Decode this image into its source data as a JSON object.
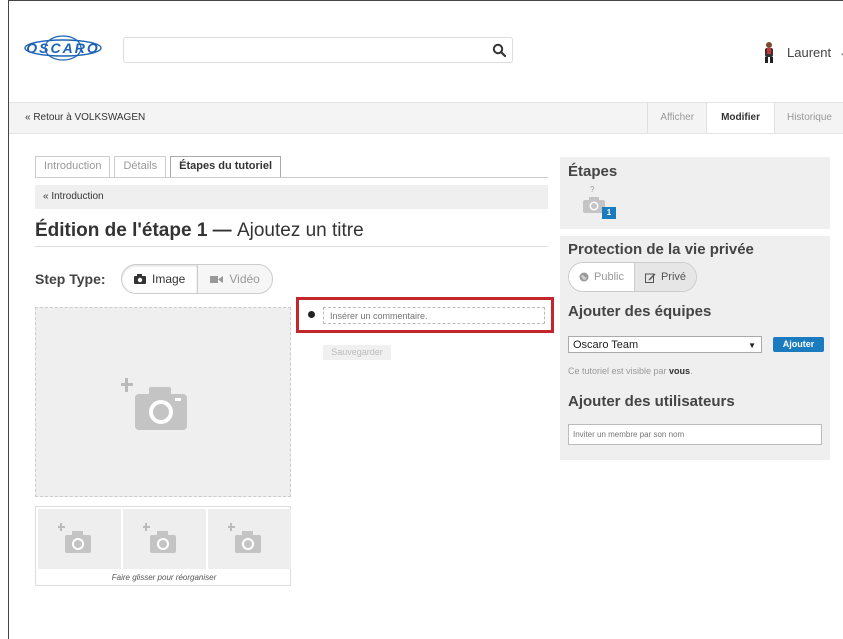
{
  "header": {
    "logo_text": "OSCARO",
    "search": {
      "value": "",
      "placeholder": ""
    },
    "user_name": "Laurent",
    "user_caret": "⌄"
  },
  "subnav": {
    "back_link": "« Retour à VOLKSWAGEN",
    "tabs": [
      {
        "label": "Afficher",
        "active": false
      },
      {
        "label": "Modifier",
        "active": true
      },
      {
        "label": "Historique",
        "active": false
      }
    ]
  },
  "editor": {
    "tabs": [
      {
        "label": "Introduction",
        "active": false
      },
      {
        "label": "Détails",
        "active": false
      },
      {
        "label": "Étapes du tutoriel",
        "active": true
      }
    ],
    "breadcrumb": "« Introduction",
    "title_bold": "Édition de l'étape 1",
    "title_sep": " — ",
    "title_rest": "Ajoutez un titre",
    "step_type_label": "Step Type:",
    "step_types": [
      {
        "label": "Image",
        "active": true,
        "icon": "camera-icon"
      },
      {
        "label": "Vidéo",
        "active": false,
        "icon": "video-icon"
      }
    ],
    "thumb_hint": "Faire glisser pour réorganiser",
    "comment_placeholder": "Insérer un commentaire.",
    "save_label": "Sauvegarder"
  },
  "sidebar": {
    "steps_title": "Étapes",
    "step_thumb_question": "?",
    "step_thumb_number": "1",
    "privacy_title": "Protection de la vie privée",
    "privacy_options": [
      {
        "label": "Public",
        "active": false,
        "icon": "globe-icon"
      },
      {
        "label": "Privé",
        "active": true,
        "icon": "edit-icon"
      }
    ],
    "teams_title": "Ajouter des équipes",
    "team_selected": "Oscaro Team",
    "add_label": "Ajouter",
    "visible_prefix": "Ce tutoriel est visible par ",
    "visible_who": "vous",
    "visible_suffix": ".",
    "users_title": "Ajouter des utilisateurs",
    "users_placeholder": "Inviter un membre par son nom"
  },
  "colors": {
    "accent_blue": "#1a7bbf",
    "highlight_red": "#c1272d",
    "logo_blue": "#1e63b5"
  }
}
